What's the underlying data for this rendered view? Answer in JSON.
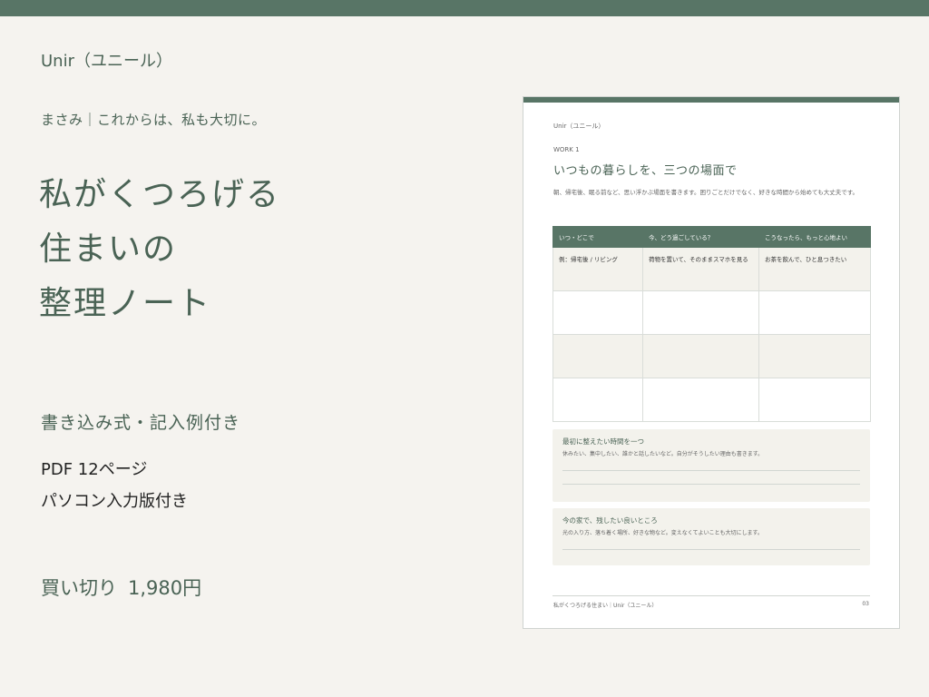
{
  "brand": "Unir（ユニール）",
  "author_line": "まさみ｜これからは、私も大切に。",
  "title_lines": [
    "私がくつろげる",
    "住まいの",
    "整理ノート"
  ],
  "feature": "書き込み式・記入例付き",
  "spec_pages": "PDF 12ページ",
  "spec_input": "パソコン入力版付き",
  "price_label": "買い切り",
  "price_value": "1,980円",
  "preview": {
    "brand": "Unir（ユニール）",
    "work_label": "WORK 1",
    "heading": "いつもの暮らしを、三つの場面で",
    "description": "朝、帰宅後、眠る前など、思い浮かぶ場面を書きます。困りごとだけでなく、好きな時間から始めても大丈夫です。",
    "table": {
      "headers": [
        "いつ・どこで",
        "今、どう過ごしている？",
        "こうなったら、もっと心地よい"
      ],
      "example_row": [
        "例：帰宅後 / リビング",
        "荷物を置いて、そのままスマホを見る",
        "お茶を飲んで、ひと息つきたい"
      ]
    },
    "box1": {
      "title": "最初に整えたい時間を一つ",
      "desc": "休みたい、集中したい、誰かと話したいなど。自分がそうしたい理由も書きます。"
    },
    "box2": {
      "title": "今の家で、残したい良いところ",
      "desc": "光の入り方、落ち着く場所、好きな物など。変えなくてよいことも大切にします。"
    },
    "footer": "私がくつろげる住まい｜Unir（ユニール）",
    "page_number": "03"
  },
  "colors": {
    "accent": "#587566",
    "text": "#4a6355",
    "background": "#f5f3ef"
  }
}
